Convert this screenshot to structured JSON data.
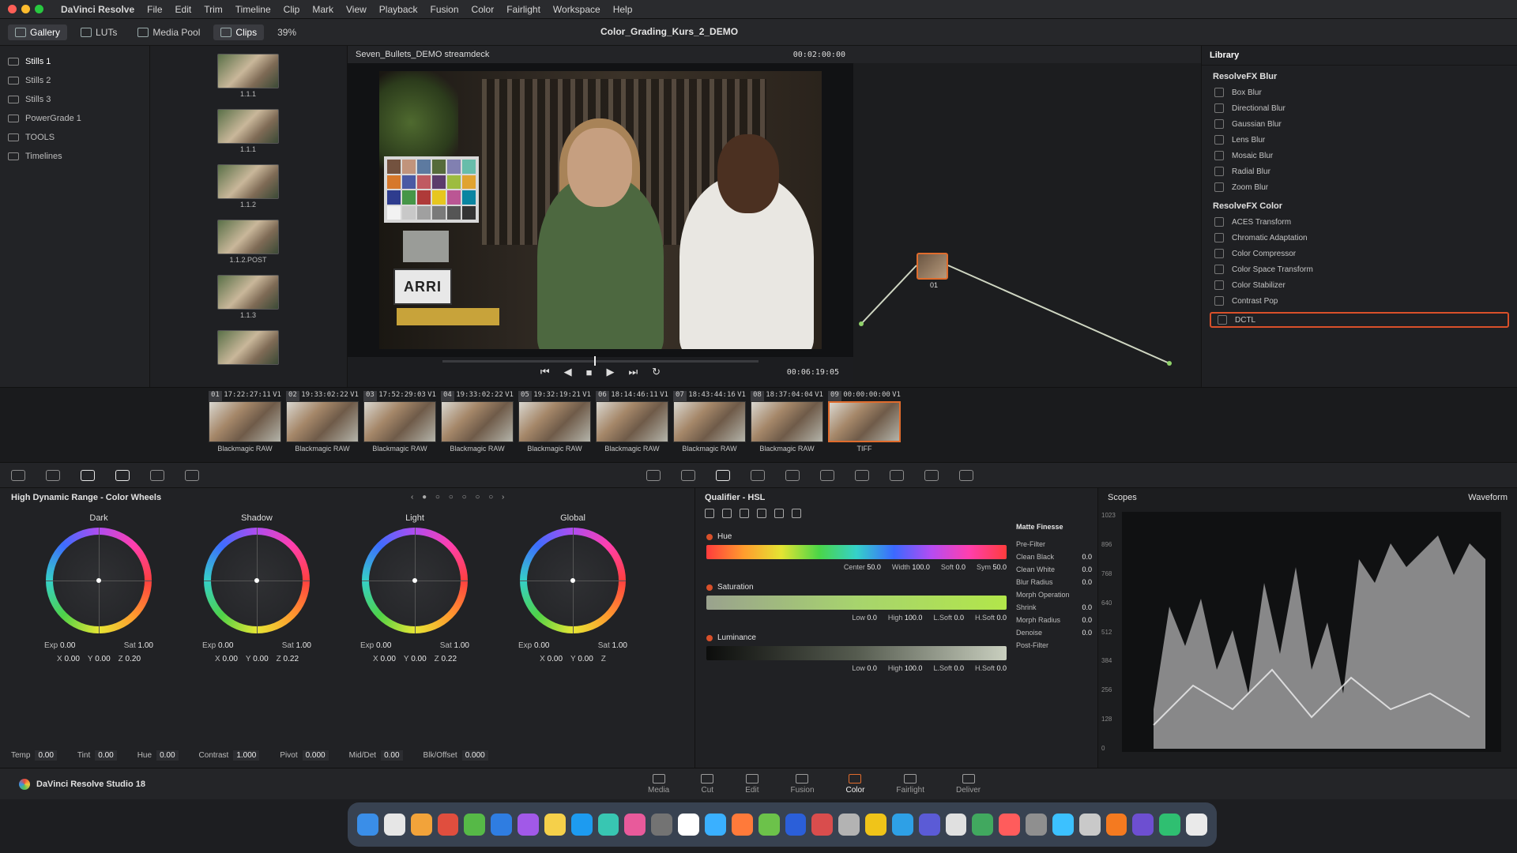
{
  "menubar": {
    "app_name": "DaVinci Resolve",
    "items": [
      "File",
      "Edit",
      "Trim",
      "Timeline",
      "Clip",
      "Mark",
      "View",
      "Playback",
      "Fusion",
      "Color",
      "Fairlight",
      "Workspace",
      "Help"
    ]
  },
  "toolbar": {
    "gallery": "Gallery",
    "luts": "LUTs",
    "media_pool": "Media Pool",
    "clips": "Clips",
    "zoom": "39%",
    "project_title": "Color_Grading_Kurs_2_DEMO"
  },
  "gallery": {
    "items": [
      "Stills 1",
      "Stills 2",
      "Stills 3",
      "PowerGrade 1",
      "TOOLS",
      "Timelines"
    ]
  },
  "stills": [
    {
      "label": "1.1.1"
    },
    {
      "label": "1.1.1"
    },
    {
      "label": "1.1.2"
    },
    {
      "label": "1.1.2.POST"
    },
    {
      "label": "1.1.3"
    },
    {
      "label": ""
    }
  ],
  "viewer": {
    "title": "Seven_Bullets_DEMO streamdeck",
    "timecode": "00:02:00:00",
    "playhead": "00:06:19:05",
    "slate_text": "ARRI"
  },
  "nodes": {
    "node_label": "01"
  },
  "library": {
    "tabs": [
      "Library"
    ],
    "section1": "ResolveFX Blur",
    "items1": [
      "Box Blur",
      "Directional Blur",
      "Gaussian Blur",
      "Lens Blur",
      "Mosaic Blur",
      "Radial Blur",
      "Zoom Blur"
    ],
    "section2": "ResolveFX Color",
    "items2": [
      "ACES Transform",
      "Chromatic Adaptation",
      "Color Compressor",
      "Color Space Transform",
      "Color Stabilizer",
      "Contrast Pop",
      "DCTL"
    ]
  },
  "clips": [
    {
      "num": "01",
      "tc": "17:22:27:11",
      "track": "V1",
      "name": "Blackmagic RAW"
    },
    {
      "num": "02",
      "tc": "19:33:02:22",
      "track": "V1",
      "name": "Blackmagic RAW"
    },
    {
      "num": "03",
      "tc": "17:52:29:03",
      "track": "V1",
      "name": "Blackmagic RAW"
    },
    {
      "num": "04",
      "tc": "19:33:02:22",
      "track": "V1",
      "name": "Blackmagic RAW"
    },
    {
      "num": "05",
      "tc": "19:32:19:21",
      "track": "V1",
      "name": "Blackmagic RAW"
    },
    {
      "num": "06",
      "tc": "18:14:46:11",
      "track": "V1",
      "name": "Blackmagic RAW"
    },
    {
      "num": "07",
      "tc": "18:43:44:16",
      "track": "V1",
      "name": "Blackmagic RAW"
    },
    {
      "num": "08",
      "tc": "18:37:04:04",
      "track": "V1",
      "name": "Blackmagic RAW"
    },
    {
      "num": "09",
      "tc": "00:00:00:00",
      "track": "V1",
      "name": "TIFF"
    }
  ],
  "wheels_panel": {
    "title": "High Dynamic Range - Color Wheels",
    "wheels": [
      {
        "name": "Dark",
        "exp": "0.00",
        "sat": "1.00",
        "x": "0.00",
        "y": "0.00",
        "z": "0.20"
      },
      {
        "name": "Shadow",
        "exp": "0.00",
        "sat": "1.00",
        "x": "0.00",
        "y": "0.00",
        "z": "0.22"
      },
      {
        "name": "Light",
        "exp": "0.00",
        "sat": "1.00",
        "x": "0.00",
        "y": "0.00",
        "z": "0.22"
      },
      {
        "name": "Global",
        "exp": "0.00",
        "sat": "1.00",
        "x": "0.00",
        "y": "0.00",
        "z": ""
      }
    ],
    "bottom": [
      {
        "label": "Temp",
        "value": "0.00"
      },
      {
        "label": "Tint",
        "value": "0.00"
      },
      {
        "label": "Hue",
        "value": "0.00"
      },
      {
        "label": "Contrast",
        "value": "1.000"
      },
      {
        "label": "Pivot",
        "value": "0.000"
      },
      {
        "label": "Mid/Det",
        "value": "0.00"
      },
      {
        "label": "Blk/Offset",
        "value": "0.000"
      }
    ]
  },
  "qualifier": {
    "title": "Qualifier - HSL",
    "hue": {
      "label": "Hue",
      "center": "50.0",
      "width": "100.0",
      "soft": "0.0",
      "sym": "50.0"
    },
    "saturation": {
      "label": "Saturation",
      "low": "0.0",
      "high": "100.0",
      "lsoft": "0.0",
      "hsoft": "0.0"
    },
    "luminance": {
      "label": "Luminance",
      "low": "0.0",
      "high": "100.0",
      "lsoft": "0.0",
      "hsoft": "0.0"
    },
    "matte": {
      "title": "Matte Finesse",
      "rows": [
        {
          "label": "Pre-Filter",
          "value": ""
        },
        {
          "label": "Clean Black",
          "value": "0.0"
        },
        {
          "label": "Clean White",
          "value": "0.0"
        },
        {
          "label": "Blur Radius",
          "value": "0.0"
        },
        {
          "label": "Morph Operation",
          "value": ""
        },
        {
          "label": "Shrink",
          "value": "0.0"
        },
        {
          "label": "Morph Radius",
          "value": "0.0"
        },
        {
          "label": "Denoise",
          "value": "0.0"
        },
        {
          "label": "Post-Filter",
          "value": ""
        }
      ]
    }
  },
  "scopes": {
    "title": "Scopes",
    "mode": "Waveform",
    "axis": [
      "1023",
      "896",
      "768",
      "640",
      "512",
      "384",
      "256",
      "128",
      "0"
    ]
  },
  "pages": {
    "brand": "DaVinci Resolve Studio 18",
    "tabs": [
      {
        "label": "Media",
        "active": false
      },
      {
        "label": "Cut",
        "active": false
      },
      {
        "label": "Edit",
        "active": false
      },
      {
        "label": "Fusion",
        "active": false
      },
      {
        "label": "Color",
        "active": true
      },
      {
        "label": "Fairlight",
        "active": false
      },
      {
        "label": "Deliver",
        "active": false
      }
    ]
  },
  "colors": {
    "accent": "#e06c2d",
    "highlight": "#d9502a",
    "panel": "#212225"
  }
}
